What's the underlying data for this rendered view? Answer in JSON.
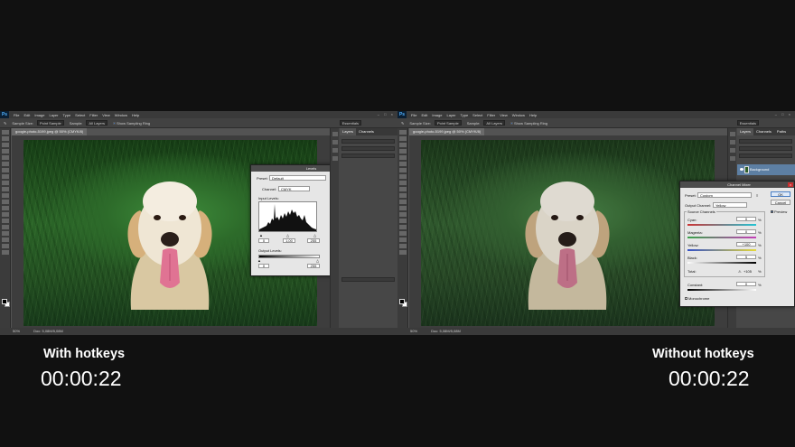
{
  "menu": [
    "File",
    "Edit",
    "Image",
    "Layer",
    "Type",
    "Select",
    "Filter",
    "View",
    "Window",
    "Help"
  ],
  "app_logo": "Ps",
  "window_controls": "– □ ×",
  "options_bar": {
    "sample_size_label": "Sample Size:",
    "sample_size_value": "Point Sample",
    "sample_label": "Sample:",
    "sample_value": "All Layers",
    "show_ring": "Show Sampling Ring",
    "workspace": "Essentials"
  },
  "document": {
    "tab": "google-photo-5199.jpeg @ 50% (CMYK/8)",
    "zoom": "50%",
    "doc_size": "Doc: 5,08M/5,08M"
  },
  "panels": {
    "tabs": [
      "Layers",
      "Channels",
      "Paths"
    ],
    "kind_label": "Kind",
    "blend_mode": "Normal",
    "layer_name": "Background"
  },
  "levels_dialog": {
    "title": "Levels",
    "preset_label": "Preset:",
    "preset_value": "Default",
    "channel_label": "Channel:",
    "channel_value": "CMYK",
    "input_label": "Input Levels:",
    "input_values": [
      "0",
      "1,00",
      "255"
    ],
    "output_label": "Output Levels:",
    "output_values": [
      "0",
      "255"
    ],
    "buttons": [
      "OK",
      "Cancel",
      "Auto",
      "Options..."
    ],
    "preview": "Preview"
  },
  "channel_mixer": {
    "title": "Channel Mixer",
    "preset_label": "Preset:",
    "preset_value": "Custom",
    "output_label": "Output Channel:",
    "output_value": "Yellow",
    "source_label": "Source Channels",
    "channels": [
      {
        "name": "Cyan:",
        "value": "0"
      },
      {
        "name": "Magenta:",
        "value": "0"
      },
      {
        "name": "Yellow:",
        "value": "+100"
      },
      {
        "name": "Black:",
        "value": "5"
      }
    ],
    "total_label": "Total:",
    "total_value": "+105",
    "constant_label": "Constant:",
    "constant_value": "0",
    "percent": "%",
    "monochrome": "Monochrome",
    "buttons": [
      "OK",
      "Cancel"
    ],
    "preview": "Preview"
  },
  "captions": {
    "left_label": "With hotkeys",
    "left_time": "00:00:22",
    "right_label": "Without hotkeys",
    "right_time": "00:00:22"
  },
  "colors": {
    "background": "#111111",
    "workspace": "#535353",
    "selected_layer": "#5d7fa3",
    "caption_text": "#ffffff"
  }
}
